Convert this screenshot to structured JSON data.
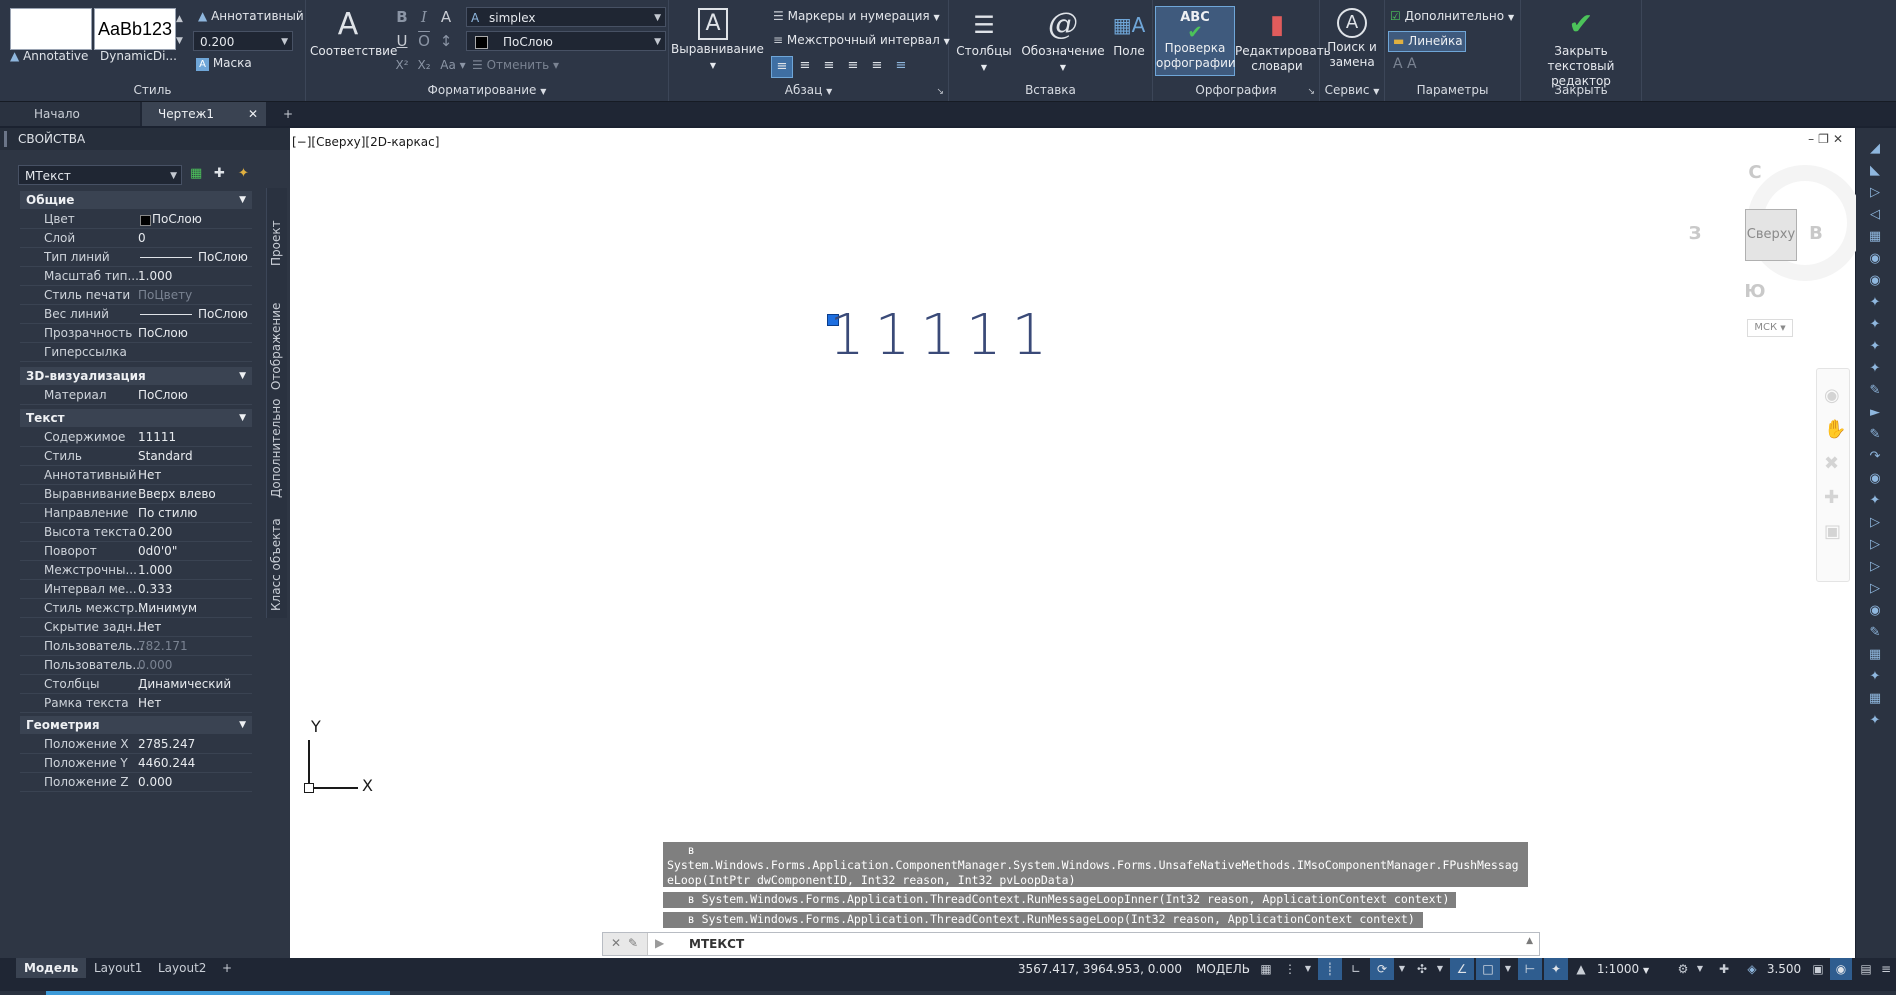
{
  "ribbon": {
    "style": {
      "title": "Стиль",
      "style1_label": "Annotative",
      "style2_preview": "AaBb123",
      "style2_label": "DynamicDi...",
      "annotative_label": "Аннотативный",
      "height_value": "0.200",
      "mask_label": "Маска"
    },
    "formatting": {
      "title": "Форматирование",
      "match_label": "Соответствие",
      "font_value": "simplex",
      "color_value": "ПоСлою",
      "undo_label": "Отменить"
    },
    "paragraph": {
      "title": "Абзац",
      "align_label": "Выравнивание",
      "bullets_label": "Маркеры и нумерация",
      "spacing_label": "Межстрочный интервал"
    },
    "insert": {
      "title": "Вставка",
      "columns_label": "Столбцы",
      "symbol_label": "Обозначение",
      "field_label": "Поле"
    },
    "spelling": {
      "title": "Орфография",
      "spellcheck_label": "Проверка орфографии",
      "spellcheck_line1": "Проверка",
      "spellcheck_line2": "орфографии",
      "dict_line1": "Редактировать",
      "dict_line2": "словари",
      "abc": "ABC"
    },
    "tools": {
      "title": "Сервис",
      "find_line1": "Поиск и",
      "find_line2": "замена"
    },
    "options": {
      "title": "Параметры",
      "more_label": "Дополнительно",
      "ruler_label": "Линейка"
    },
    "close": {
      "title": "Закрыть",
      "close_line1": "Закрыть",
      "close_line2": "текстовый редактор"
    }
  },
  "filetabs": {
    "start": "Начало",
    "drawing": "Чертеж1"
  },
  "properties": {
    "title": "СВОЙСТВА",
    "object_type": "МТекст",
    "sections": {
      "general": "Общие",
      "viz3d": "3D-визуализация",
      "text": "Текст",
      "geometry": "Геометрия"
    },
    "general": [
      {
        "k": "Цвет",
        "v": "ПоСлою"
      },
      {
        "k": "Слой",
        "v": "0"
      },
      {
        "k": "Тип линий",
        "v": "ПоСлою"
      },
      {
        "k": "Масштаб тип...",
        "v": "1.000"
      },
      {
        "k": "Стиль печати",
        "v": "ПоЦвету"
      },
      {
        "k": "Вес линий",
        "v": "ПоСлою"
      },
      {
        "k": "Прозрачность",
        "v": "ПоСлою"
      },
      {
        "k": "Гиперссылка",
        "v": ""
      }
    ],
    "viz3d": [
      {
        "k": "Материал",
        "v": "ПоСлою"
      }
    ],
    "text": [
      {
        "k": "Содержимое",
        "v": "11111"
      },
      {
        "k": "Стиль",
        "v": "Standard"
      },
      {
        "k": "Аннотативный",
        "v": "Нет"
      },
      {
        "k": "Выравнивание",
        "v": "Вверх влево"
      },
      {
        "k": "Направление",
        "v": "По стилю"
      },
      {
        "k": "Высота текста",
        "v": "0.200"
      },
      {
        "k": "Поворот",
        "v": "0d0'0\""
      },
      {
        "k": "Межстрочны...",
        "v": "1.000"
      },
      {
        "k": "Интервал ме...",
        "v": "0.333"
      },
      {
        "k": "Стиль межстр...",
        "v": "Минимум"
      },
      {
        "k": "Скрытие задн...",
        "v": "Нет"
      },
      {
        "k": "Пользователь...",
        "v": "782.171"
      },
      {
        "k": "Пользователь...",
        "v": "0.000"
      },
      {
        "k": "Столбцы",
        "v": "Динамический"
      },
      {
        "k": "Рамка текста",
        "v": "Нет"
      }
    ],
    "geometry": [
      {
        "k": "Положение X",
        "v": "2785.247"
      },
      {
        "k": "Положение Y",
        "v": "4460.244"
      },
      {
        "k": "Положение Z",
        "v": "0.000"
      }
    ],
    "side_tabs": [
      "Проект",
      "Отображение",
      "Дополнительно",
      "Класс объекта"
    ]
  },
  "viewport": {
    "label": "[−][Сверху][2D-каркас]",
    "mtext": "11111",
    "viewcube": {
      "face": "Сверху",
      "n": "С",
      "s": "Ю",
      "w": "З",
      "e": "В",
      "ucs": "МСК"
    },
    "axis_x": "X",
    "axis_y": "Y"
  },
  "command": {
    "messages": [
      "   в\nSystem.Windows.Forms.Application.ComponentManager.System.Windows.Forms.UnsafeNativeMethods.IMsoComponentManager.FPushMessag\neLoop(IntPtr dwComponentID, Int32 reason, Int32 pvLoopData)",
      "   в System.Windows.Forms.Application.ThreadContext.RunMessageLoopInner(Int32 reason, ApplicationContext context)",
      "   в System.Windows.Forms.Application.ThreadContext.RunMessageLoop(Int32 reason, ApplicationContext context)"
    ],
    "prompt": "МТЕКСТ"
  },
  "layouts": [
    "Модель",
    "Layout1",
    "Layout2"
  ],
  "status": {
    "coords": "3567.417, 3964.953, 0.000",
    "space": "МОДЕЛЬ",
    "scale": "1:1000",
    "lineweight": "3.500"
  },
  "colors": {
    "accent": "#0a6ad6",
    "ribbon_bg": "#2d3646",
    "canvas_bg": "#ffffff",
    "command_msg_bg": "#7f7f7f"
  }
}
